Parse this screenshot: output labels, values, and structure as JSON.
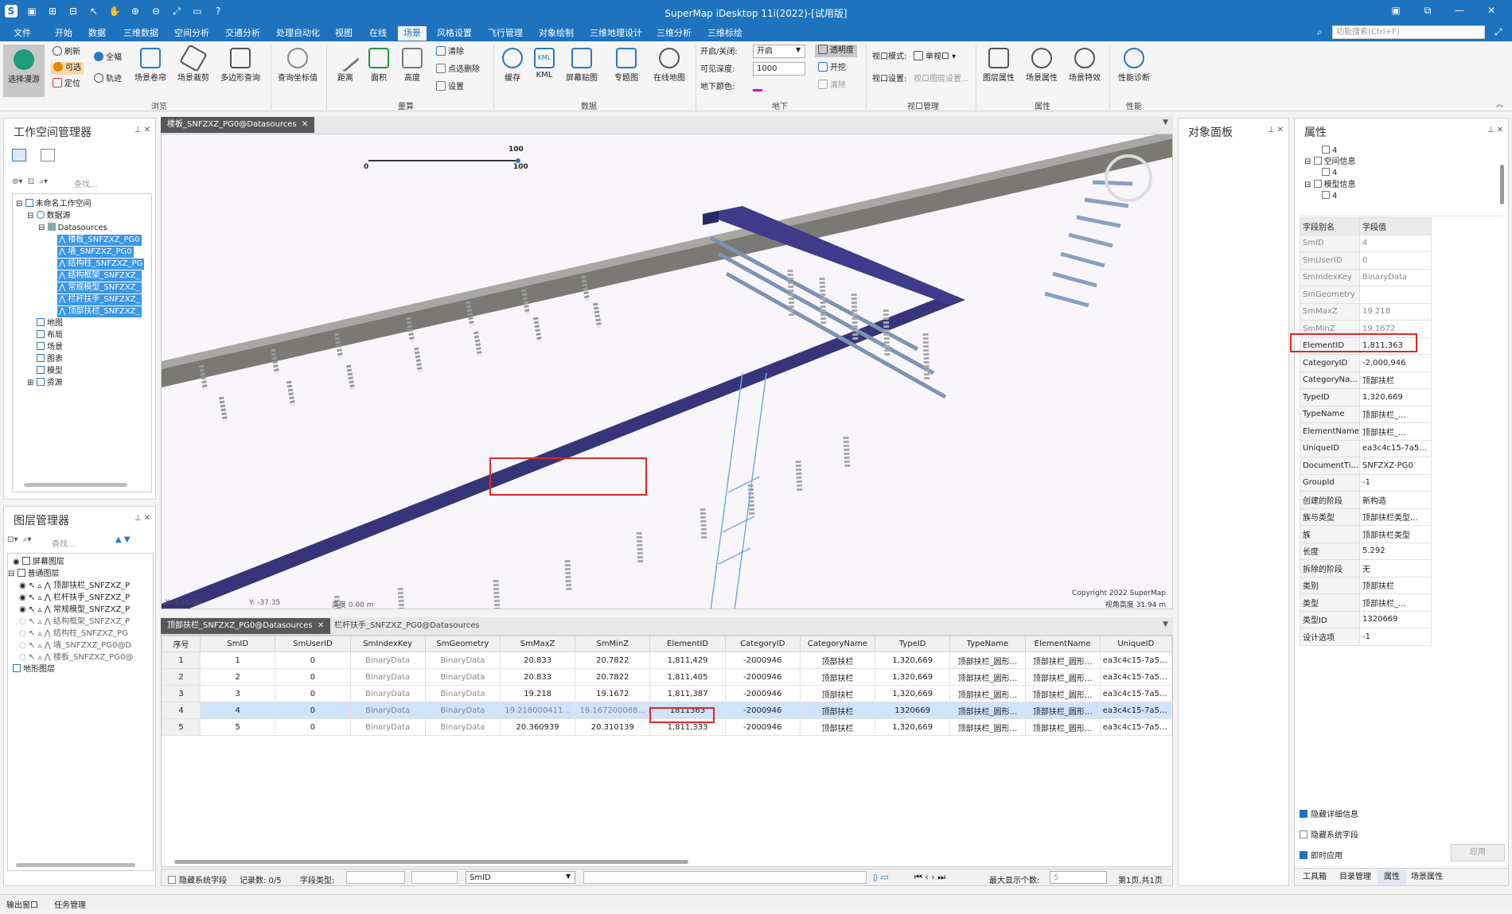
{
  "window": {
    "title": "SuperMap iDesktop 11i(2022)-[试用版]"
  },
  "menu": [
    "文件",
    "开始",
    "数据",
    "三维数据",
    "空间分析",
    "交通分析",
    "处理自动化",
    "视图",
    "在线",
    "场景",
    "风格设置",
    "飞行管理",
    "对象绘制",
    "三维地理设计",
    "三维分析",
    "三维标绘"
  ],
  "search": {
    "placeholder": "功能搜索(Ctrl+F)"
  },
  "ribbon": {
    "select_roam": "选择漫游",
    "refresh": "刷新",
    "full": "全幅",
    "selectable": "可选",
    "locate": "定位",
    "track": "轨迹",
    "scene_roll": "场景卷帘",
    "scene_clip": "场景裁剪",
    "polygon_query": "多边形查询",
    "query_coord": "查询坐标值",
    "distance": "距离",
    "area": "面积",
    "height": "高度",
    "clear": "清除",
    "point_delete": "点选删除",
    "settings": "设置",
    "cache": "缓存",
    "kml": "KML",
    "screen_paste": "屏幕贴图",
    "thematic": "专题图",
    "online_map": "在线地图",
    "onoff_label": "开启/关闭:",
    "onoff_value": "开启",
    "visible_depth_label": "可见深度:",
    "visible_depth_value": "1000",
    "underground_color_label": "地下颜色:",
    "transparency": "透明度",
    "dig": "开挖",
    "clear2": "清除",
    "viewport_mode_label": "视口模式:",
    "viewport_mode_value": "单视口",
    "viewport_settings_label": "视口设置:",
    "viewport_settings_value": "视口图层设置...",
    "layer_props": "图层属性",
    "scene_props": "场景属性",
    "scene_effects": "场景特效",
    "perf_diag": "性能诊断",
    "groups": {
      "browse": "浏览",
      "measure": "量算",
      "data": "数据",
      "underground": "地下",
      "viewport": "视口管理",
      "props": "属性",
      "perf": "性能"
    }
  },
  "workspace": {
    "title": "工作空间管理器",
    "search_placeholder": "查找...",
    "root": "未命名工作空间",
    "datasources": "数据源",
    "ds": "Datasources",
    "items": [
      "楼板_SNFZXZ_PG0",
      "墙_SNFZXZ_PG0",
      "结构柱_SNFZXZ_PG",
      "结构框架_SNFZXZ_",
      "常规模型_SNFZXZ_",
      "栏杆扶手_SNFZXZ_",
      "顶部扶栏_SNFZXZ_"
    ],
    "others": [
      "地图",
      "布局",
      "场景",
      "图表",
      "模型",
      "资源"
    ]
  },
  "layers": {
    "title": "图层管理器",
    "search_placeholder": "查找...",
    "screen": "屏幕图层",
    "normal": "普通图层",
    "terrain": "地形图层",
    "items": [
      "顶部扶栏_SNFZXZ_P",
      "栏杆扶手_SNFZXZ_P",
      "常规模型_SNFZXZ_P",
      "结构框架_SNFZXZ_P",
      "结构柱_SNFZXZ_PG",
      "墙_SNFZXZ_PG0@D",
      "楼板_SNFZXZ_PG0@"
    ]
  },
  "scene": {
    "tab": "楼板_SNFZXZ_PG0@Datasources",
    "scale_top": "100",
    "scale_left": "0",
    "scale_right": "100",
    "status_left": "X: 4.16.05",
    "status_mid": "Y: -37.35",
    "status_h": "高度 0.00 m",
    "copyright": "Copyright 2022 SuperMap",
    "eye_height": "视角高度 31.94 m"
  },
  "attr_tabs": [
    "顶部扶栏_SNFZXZ_PG0@Datasources",
    "栏杆扶手_SNFZXZ_PG0@Datasources"
  ],
  "table": {
    "headers": [
      "序号",
      "SmID",
      "SmUserID",
      "SmIndexKey",
      "SmGeometry",
      "SmMaxZ",
      "SmMinZ",
      "ElementID",
      "CategoryID",
      "CategoryName",
      "TypeID",
      "TypeName",
      "ElementName",
      "UniqueID"
    ],
    "rows": [
      [
        "1",
        "1",
        "0",
        "BinaryData",
        "BinaryData",
        "20.833",
        "20.7822",
        "1,811,429",
        "-2000946",
        "顶部扶栏",
        "1,320,669",
        "顶部扶栏_圆形...",
        "顶部扶栏_圆形...",
        "ea3c4c15-7a5b..."
      ],
      [
        "2",
        "2",
        "0",
        "BinaryData",
        "BinaryData",
        "20.833",
        "20.7822",
        "1,811,405",
        "-2000946",
        "顶部扶栏",
        "1,320,669",
        "顶部扶栏_圆形...",
        "顶部扶栏_圆形...",
        "ea3c4c15-7a5b..."
      ],
      [
        "3",
        "3",
        "0",
        "BinaryData",
        "BinaryData",
        "19.218",
        "19.1672",
        "1,811,387",
        "-2000946",
        "顶部扶栏",
        "1,320,669",
        "顶部扶栏_圆形...",
        "顶部扶栏_圆形...",
        "ea3c4c15-7a5b..."
      ],
      [
        "4",
        "4",
        "0",
        "BinaryData",
        "BinaryData",
        "19.218000411...",
        "19.167200088...",
        "1811363",
        "-2000946",
        "顶部扶栏",
        "1320669",
        "顶部扶栏_圆形...",
        "顶部扶栏_圆形...",
        "ea3c4c15-7a5b..."
      ],
      [
        "5",
        "5",
        "0",
        "BinaryData",
        "BinaryData",
        "20.360939",
        "20.310139",
        "1,811,333",
        "-2000946",
        "顶部扶栏",
        "1,320,669",
        "顶部扶栏_圆形...",
        "顶部扶栏_圆形...",
        "ea3c4c15-7a5b..."
      ]
    ]
  },
  "table_status": {
    "hide_sys": "隐藏系统字段",
    "count": "记录数: 0/5",
    "field_type": "字段类型:",
    "field_value": "SmID",
    "max_display": "最大显示个数:",
    "max_display_value": "5",
    "page": "第1页,共1页"
  },
  "object_panel": {
    "title": "对象面板"
  },
  "props": {
    "title": "属性",
    "tree": [
      "4",
      "空间信息",
      "4",
      "模型信息",
      "4"
    ],
    "col_key": "字段别名",
    "col_val": "字段值",
    "rows": [
      [
        "SmID",
        "4"
      ],
      [
        "SmUserID",
        "0"
      ],
      [
        "SmIndexKey",
        "BinaryData"
      ],
      [
        "SmGeometry",
        ""
      ],
      [
        "SmMaxZ",
        "19.218"
      ],
      [
        "SmMinZ",
        "19.1672"
      ],
      [
        "ElementID",
        "1,811,363"
      ],
      [
        "CategoryID",
        "-2,000,946"
      ],
      [
        "CategoryNa...",
        "顶部扶栏"
      ],
      [
        "TypeID",
        "1,320,669"
      ],
      [
        "TypeName",
        "顶部扶栏_..."
      ],
      [
        "ElementName",
        "顶部扶栏_..."
      ],
      [
        "UniqueID",
        "ea3c4c15-7a5..."
      ],
      [
        "DocumentTitle",
        "SNFZXZ-PG0"
      ],
      [
        "GroupId",
        "-1"
      ],
      [
        "创建的阶段",
        "新构造"
      ],
      [
        "族与类型",
        "顶部扶栏类型..."
      ],
      [
        "族",
        "顶部扶栏类型"
      ],
      [
        "长度",
        "5.292"
      ],
      [
        "拆除的阶段",
        "无"
      ],
      [
        "类别",
        "顶部扶栏"
      ],
      [
        "类型",
        "顶部扶栏_..."
      ],
      [
        "类型ID",
        "1320669"
      ],
      [
        "设计选项",
        "-1"
      ]
    ],
    "hide_detail": "隐藏详细信息",
    "hide_sys": "隐藏系统字段",
    "instant": "即时应用",
    "apply": "应用",
    "bottom_tabs": [
      "工具箱",
      "目录管理",
      "属性",
      "场景属性"
    ]
  },
  "statusbar": {
    "output": "输出窗口",
    "tasks": "任务管理"
  },
  "colors": {
    "accent": "#1e73be",
    "select": "#3b97e8",
    "rail": "#35357a",
    "highlight": "#e02626"
  }
}
